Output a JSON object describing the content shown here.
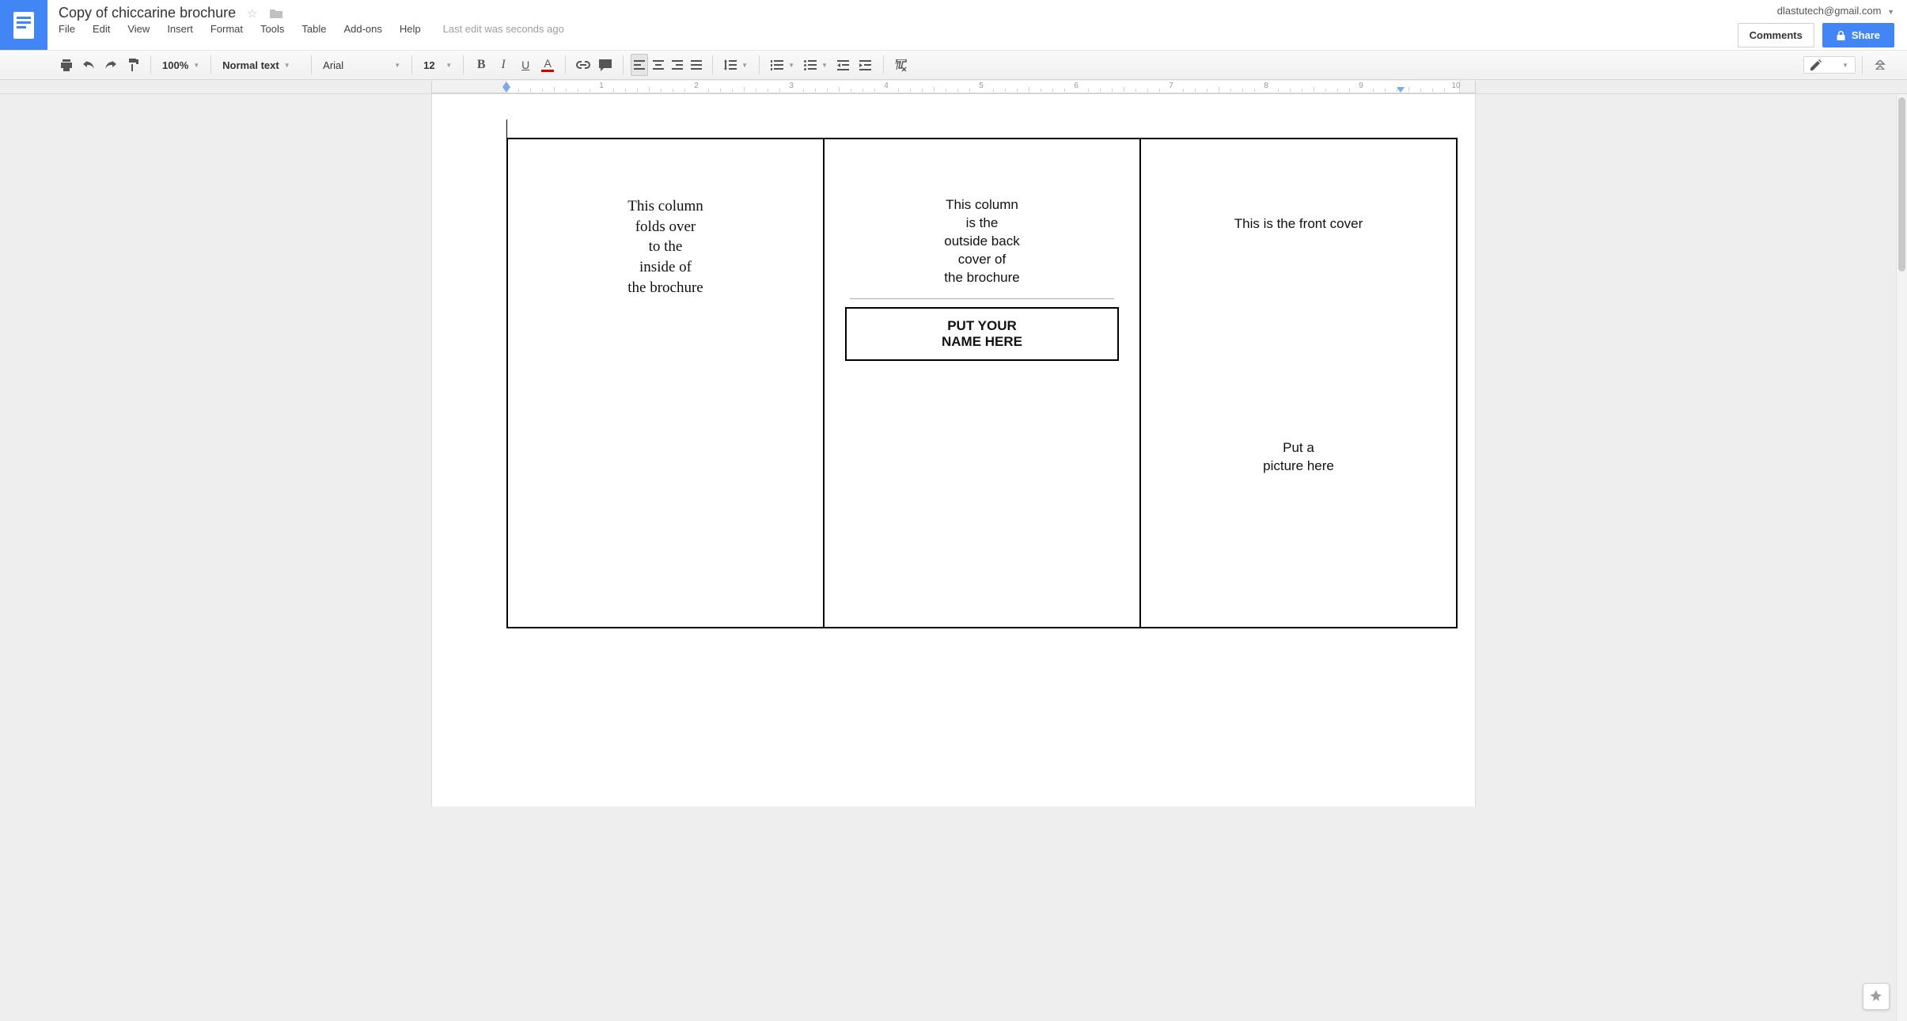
{
  "header": {
    "doc_title": "Copy of chiccarine brochure",
    "account_email": "dlastutech@gmail.com",
    "comments_label": "Comments",
    "share_label": "Share",
    "last_edit": "Last edit was seconds ago"
  },
  "menus": {
    "file": "File",
    "edit": "Edit",
    "view": "View",
    "insert": "Insert",
    "format": "Format",
    "tools": "Tools",
    "table": "Table",
    "addons": "Add-ons",
    "help": "Help"
  },
  "toolbar": {
    "zoom": "100%",
    "style": "Normal text",
    "font": "Arial",
    "size": "12"
  },
  "ruler": {
    "numbers": [
      1,
      2,
      3,
      4,
      5,
      6,
      7,
      8,
      9,
      10
    ]
  },
  "document": {
    "column_left": "This column folds over to the inside of the brochure",
    "column_middle": "This column is the outside back cover of the brochure",
    "name_box_line1": "PUT YOUR",
    "name_box_line2": "NAME HERE",
    "column_right_top": "This is the front cover",
    "column_right_pic": "Put a picture here"
  }
}
